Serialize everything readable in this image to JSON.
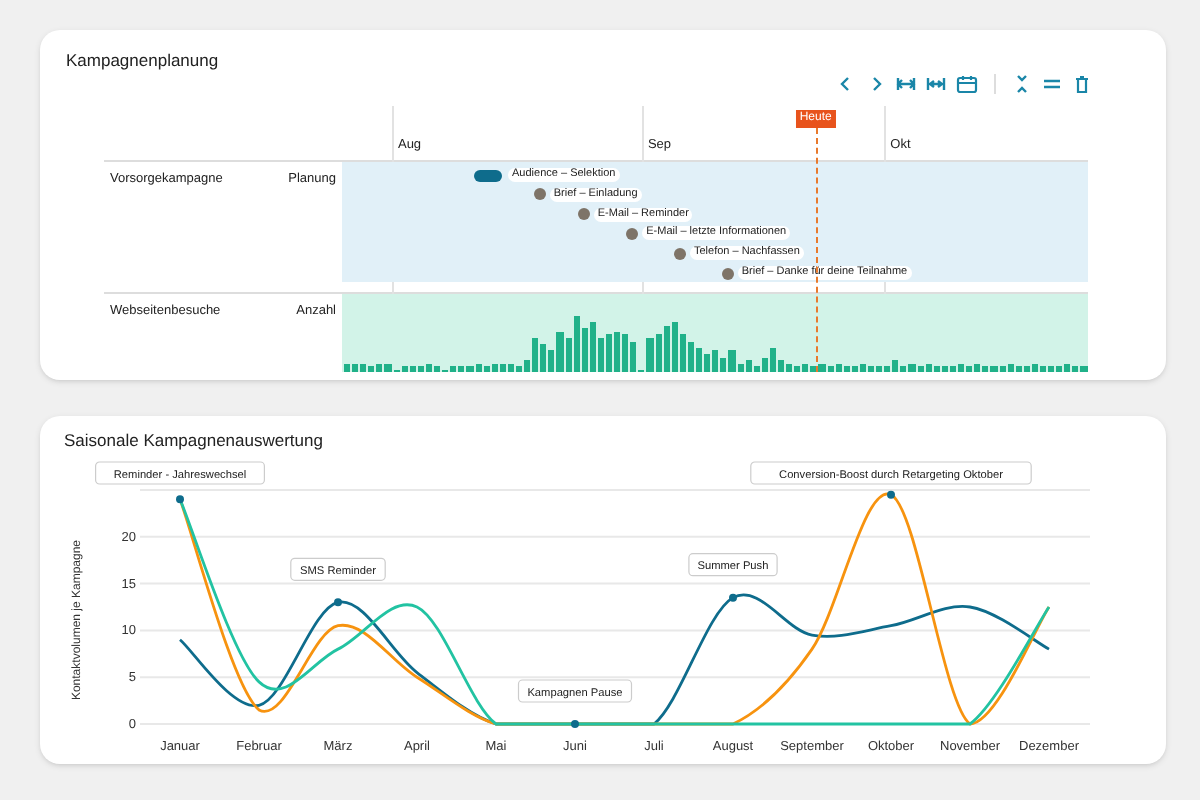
{
  "planning": {
    "title": "Kampagnenplanung",
    "months": [
      "Aug",
      "Sep",
      "Okt"
    ],
    "today_label": "Heute",
    "rows": [
      {
        "name": "Vorsorgekampagne",
        "type_label": "Planung",
        "kind": "events",
        "events": [
          {
            "label": "Audience – Selektion",
            "kind": "bar"
          },
          {
            "label": "Brief – Einladung",
            "kind": "milestone"
          },
          {
            "label": "E-Mail – Reminder",
            "kind": "milestone"
          },
          {
            "label": "E-Mail – letzte Informationen",
            "kind": "milestone"
          },
          {
            "label": "Telefon – Nachfassen",
            "kind": "milestone"
          },
          {
            "label": "Brief – Danke für deine Teilnahme",
            "kind": "milestone"
          }
        ]
      },
      {
        "name": "Webseitenbesuche",
        "type_label": "Anzahl",
        "kind": "histogram"
      }
    ]
  },
  "evaluation": {
    "title": "Saisonale Kampagnenauswertung",
    "chart_data": {
      "type": "line",
      "ylabel": "Kontaktvolumen je Kampagne",
      "categories": [
        "Januar",
        "Februar",
        "März",
        "April",
        "Mai",
        "Juni",
        "Juli",
        "August",
        "September",
        "Oktober",
        "November",
        "Dezember"
      ],
      "ylim": [
        0,
        25
      ],
      "grid": true,
      "yticks": [
        0,
        5,
        10,
        15,
        20
      ],
      "series": [
        {
          "color": "#0e6c8c",
          "values": [
            9,
            2,
            13,
            5.5,
            0,
            0,
            0,
            13.5,
            9.5,
            10.5,
            12.5,
            8
          ]
        },
        {
          "color": "#f7930f",
          "values": [
            24,
            1.5,
            10.5,
            5,
            0,
            0,
            0,
            0,
            8,
            24.5,
            0,
            12.5
          ]
        },
        {
          "color": "#22c3a2",
          "values": [
            24,
            4.5,
            8,
            12.5,
            0,
            0,
            0,
            0,
            0,
            0,
            0,
            12.5
          ]
        }
      ],
      "annotations": [
        {
          "x": "Januar",
          "y": 24,
          "text": "Reminder - Jahreswechsel"
        },
        {
          "x": "März",
          "y": 13,
          "text": "SMS Reminder"
        },
        {
          "x": "Juni",
          "y": 0,
          "text": "Kampagnen Pause"
        },
        {
          "x": "August",
          "y": 13.5,
          "text": "Summer Push"
        },
        {
          "x": "Oktober",
          "y": 24.5,
          "text": "Conversion-Boost durch Retargeting Oktober"
        }
      ]
    }
  }
}
